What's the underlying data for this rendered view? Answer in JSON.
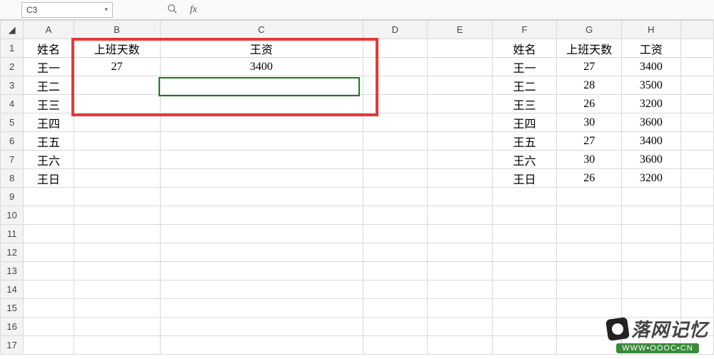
{
  "formula_bar": {
    "name_box": "C3",
    "fx_label": "fx"
  },
  "columns": [
    "A",
    "B",
    "C",
    "D",
    "E",
    "F",
    "G",
    "H"
  ],
  "row_headers": [
    "1",
    "2",
    "3",
    "4",
    "5",
    "6",
    "7",
    "8",
    "9",
    "10",
    "11",
    "12",
    "13",
    "14",
    "15",
    "16",
    "17"
  ],
  "cells": {
    "A1": "姓名",
    "B1": "上班天数",
    "C1": "王资",
    "A2": "王一",
    "B2": "27",
    "C2": "3400",
    "A3": "王二",
    "A4": "王三",
    "A5": "王四",
    "A6": "王五",
    "A7": "王六",
    "A8": "王日",
    "F1": "姓名",
    "G1": "上班天数",
    "H1": "工资",
    "F2": "王一",
    "G2": "27",
    "H2": "3400",
    "F3": "王二",
    "G3": "28",
    "H3": "3500",
    "F4": "王三",
    "G4": "26",
    "H4": "3200",
    "F5": "王四",
    "G5": "30",
    "H5": "3600",
    "F6": "王五",
    "G6": "27",
    "H6": "3400",
    "F7": "王六",
    "G7": "30",
    "H7": "3600",
    "F8": "王日",
    "G8": "26",
    "H8": "3200"
  },
  "watermark": {
    "title": "落网记忆",
    "url": "WWW▪OOOC▪CN"
  },
  "chart_data": {
    "type": "table",
    "left_table": {
      "headers": [
        "姓名",
        "上班天数",
        "王资"
      ],
      "rows": [
        [
          "王一",
          27,
          3400
        ],
        [
          "王二",
          null,
          null
        ],
        [
          "王三",
          null,
          null
        ],
        [
          "王四",
          null,
          null
        ],
        [
          "王五",
          null,
          null
        ],
        [
          "王六",
          null,
          null
        ],
        [
          "王日",
          null,
          null
        ]
      ]
    },
    "right_table": {
      "headers": [
        "姓名",
        "上班天数",
        "工资"
      ],
      "rows": [
        [
          "王一",
          27,
          3400
        ],
        [
          "王二",
          28,
          3500
        ],
        [
          "王三",
          26,
          3200
        ],
        [
          "王四",
          30,
          3600
        ],
        [
          "王五",
          27,
          3400
        ],
        [
          "王六",
          30,
          3600
        ],
        [
          "王日",
          26,
          3200
        ]
      ]
    },
    "active_cell": "C3",
    "annotation_range": "B1:D4"
  }
}
